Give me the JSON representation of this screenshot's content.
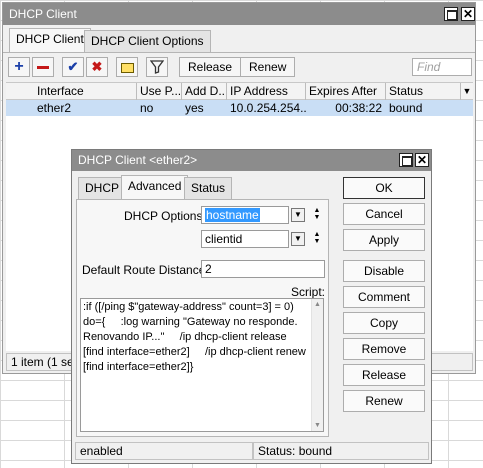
{
  "main_window": {
    "title": "DHCP Client",
    "tabs": [
      "DHCP Client",
      "DHCP Client Options"
    ],
    "toolbar": {
      "add_icon": "plus-icon",
      "remove_icon": "minus-icon",
      "enable_icon": "check-icon",
      "disable_icon": "x-icon",
      "comment_icon": "note-icon",
      "filter_icon": "filter-icon",
      "release_label": "Release",
      "renew_label": "Renew",
      "find_placeholder": "Find"
    },
    "table": {
      "headers": [
        "Interface",
        "Use P...",
        "Add D...",
        "IP Address",
        "Expires After",
        "Status"
      ],
      "rows": [
        {
          "interface": "ether2",
          "use_peer": "no",
          "add_default": "yes",
          "ip": "10.0.254.254...",
          "expires": "00:38:22",
          "status": "bound"
        }
      ]
    },
    "status_text": "1 item (1 sele"
  },
  "dialog": {
    "title": "DHCP Client <ether2>",
    "tabs": [
      "DHCP",
      "Advanced",
      "Status"
    ],
    "dhcp_options_label": "DHCP Options:",
    "dhcp_options": [
      "hostname",
      "clientid"
    ],
    "default_route_distance_label": "Default Route Distance:",
    "default_route_distance": "2",
    "script_label": "Script:",
    "script_lines": [
      ":if ([/ping $\"gateway-address\" count=3] = 0)",
      "do={     :log warning \"Gateway no responde.",
      "Renovando IP...\"     /ip dhcp-client release",
      "[find interface=ether2]     /ip dhcp-client renew",
      "[find interface=ether2]}"
    ],
    "buttons": [
      "OK",
      "Cancel",
      "Apply",
      "Disable",
      "Comment",
      "Copy",
      "Remove",
      "Release",
      "Renew"
    ],
    "status_left": "enabled",
    "status_right": "Status: bound"
  },
  "colors": {
    "titlebar": "#8c8c8c",
    "selection": "#c9def5",
    "highlight": "#3399ff"
  }
}
